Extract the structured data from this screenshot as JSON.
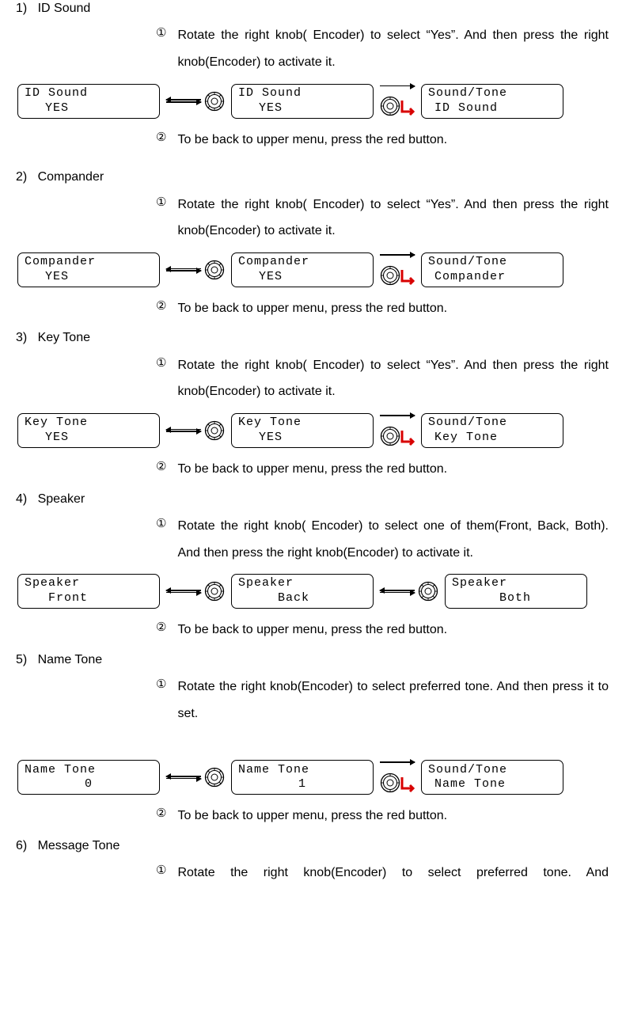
{
  "s1": {
    "num": "1)",
    "title": "ID Sound",
    "step1num": "①",
    "step1": "Rotate the right knob( Encoder) to select “Yes”. And then press the right knob(Encoder) to activate it.",
    "step2num": "②",
    "step2": "To be back to upper menu, press the red button.",
    "lcd1_l1": "ID Sound",
    "lcd1_l2": "YES",
    "lcd2_l1": "ID Sound",
    "lcd2_l2": "YES",
    "lcd3_l1": "Sound/Tone",
    "lcd3_l2": "ID Sound"
  },
  "s2": {
    "num": "2)",
    "title": "Compander",
    "step1num": "①",
    "step1": "Rotate the right knob( Encoder) to select “Yes”. And then press the right knob(Encoder) to activate it.",
    "step2num": "②",
    "step2": "To be back to upper menu, press the red button.",
    "lcd1_l1": "Compander",
    "lcd1_l2": "YES",
    "lcd2_l1": "Compander",
    "lcd2_l2": "YES",
    "lcd3_l1": "Sound/Tone",
    "lcd3_l2": "Compander"
  },
  "s3": {
    "num": "3)",
    "title": "Key Tone",
    "step1num": "①",
    "step1": "Rotate the right knob( Encoder) to select “Yes”. And then press the right knob(Encoder) to activate it.",
    "step2num": "②",
    "step2": "To be back to upper menu, press the red button.",
    "lcd1_l1": "Key Tone",
    "lcd1_l2": "YES",
    "lcd2_l1": "Key Tone",
    "lcd2_l2": "YES",
    "lcd3_l1": "Sound/Tone",
    "lcd3_l2": "Key Tone"
  },
  "s4": {
    "num": "4)",
    "title": "Speaker",
    "step1num": "①",
    "step1": "Rotate the right knob( Encoder) to select one of them(Front, Back, Both). And then press the right knob(Encoder) to activate it.",
    "step2num": "②",
    "step2": "To be back to upper menu, press the red button.",
    "lcd1_l1": "Speaker",
    "lcd1_l2": "Front",
    "lcd2_l1": "Speaker",
    "lcd2_l2": "Back",
    "lcd3_l1": "Speaker",
    "lcd3_l2": "Both"
  },
  "s5": {
    "num": "5)",
    "title": "Name Tone",
    "step1num": "①",
    "step1": "Rotate the right knob(Encoder) to select preferred tone. And then press it to set.",
    "step2num": "②",
    "step2": "To be back to upper menu, press the red button.",
    "lcd1_l1": "Name Tone",
    "lcd1_l2": "0",
    "lcd2_l1": "Name Tone",
    "lcd2_l2": "1",
    "lcd3_l1": "Sound/Tone",
    "lcd3_l2": "Name Tone"
  },
  "s6": {
    "num": "6)",
    "title": "Message Tone",
    "step1num": "①",
    "step1": "Rotate the right knob(Encoder) to select preferred tone. And"
  },
  "icons": {
    "knob": "knob-icon",
    "knobL": "knob-red-L-icon",
    "arrow_bi": "bidirectional-arrow-icon",
    "arrow_r": "right-arrow-icon"
  }
}
